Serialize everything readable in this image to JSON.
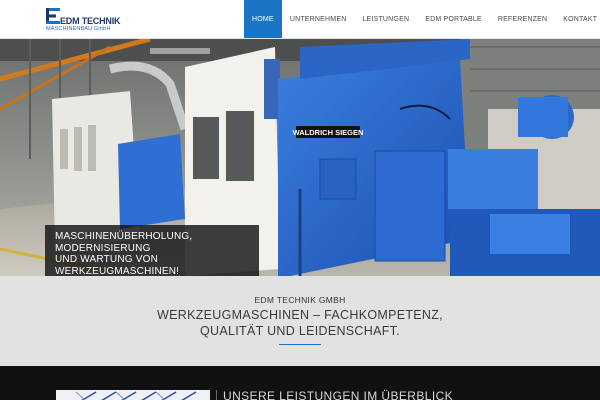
{
  "logo": {
    "name": "EDM TECHNIK",
    "sub": "MASCHINENBAU GmbH",
    "brand_blue": "#1b3768",
    "accent_blue": "#1f6fbf"
  },
  "nav": {
    "items": [
      {
        "label": "HOME",
        "active": true
      },
      {
        "label": "UNTERNEHMEN",
        "active": false
      },
      {
        "label": "LEISTUNGEN",
        "active": false
      },
      {
        "label": "EDM PORTABLE",
        "active": false
      },
      {
        "label": "REFERENZEN",
        "active": false
      },
      {
        "label": "KONTAKT",
        "active": false
      }
    ],
    "language_icon": "uk-flag-icon",
    "active_color": "#1a75c4"
  },
  "hero": {
    "machine_plate": "WALDRICH SIEGEN",
    "caption_lines": [
      "MASCHINENÜBERHOLUNG,",
      "MODERNISIERUNG",
      "UND WARTUNG VON",
      "WERKZEUGMASCHINEN!"
    ]
  },
  "intro": {
    "kicker": "EDM TECHNIK GMBH",
    "line1": "WERKZEUGMASCHINEN – FACHKOMPETENZ,",
    "line2": "QUALITÄT UND LEIDENSCHAFT."
  },
  "services": {
    "heading": "UNSERE LEISTUNGEN IM ÜBERBLICK"
  }
}
